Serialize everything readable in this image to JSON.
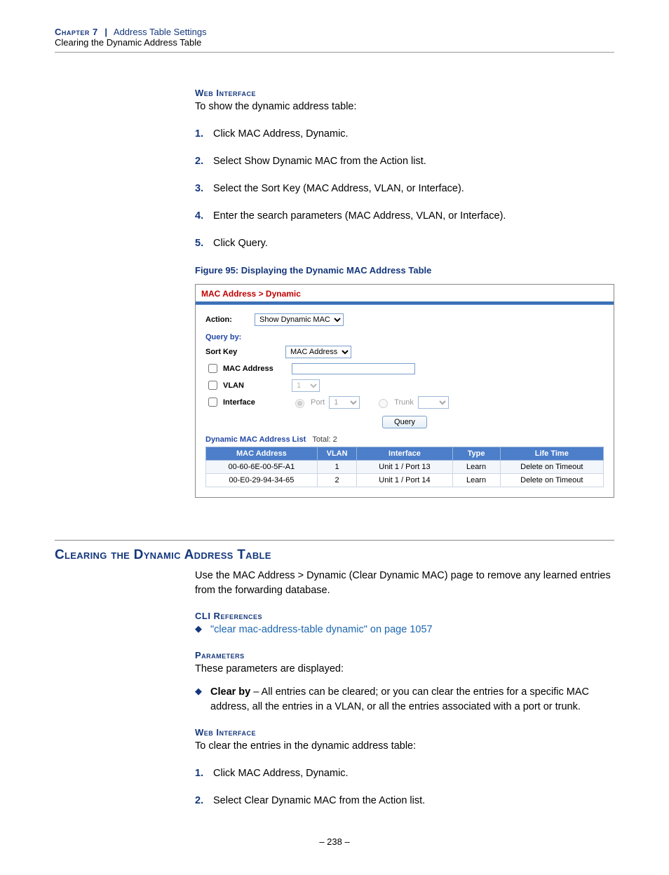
{
  "running_head": {
    "chapter": "Chapter 7",
    "sep": "|",
    "title": "Address Table Settings",
    "subtitle": "Clearing the Dynamic Address Table"
  },
  "sec_web_interface": "Web Interface",
  "intro_show": "To show the dynamic address table:",
  "steps_show": [
    "Click MAC Address, Dynamic.",
    "Select Show Dynamic MAC from the Action list.",
    "Select the Sort Key (MAC Address, VLAN, or Interface).",
    "Enter the search parameters (MAC Address, VLAN, or Interface).",
    "Click Query."
  ],
  "figure_caption": "Figure 95:  Displaying the Dynamic MAC Address Table",
  "panel": {
    "breadcrumb": "MAC Address > Dynamic",
    "action_label": "Action:",
    "action_value": "Show Dynamic MAC",
    "query_by": "Query by:",
    "sort_key_label": "Sort Key",
    "sort_key_value": "MAC Address",
    "opt_mac": "MAC Address",
    "opt_vlan": "VLAN",
    "vlan_value": "1",
    "opt_interface": "Interface",
    "radio_port_label": "Port",
    "port_value": "1",
    "radio_trunk_label": "Trunk",
    "query_btn": "Query",
    "list_title": "Dynamic MAC Address List",
    "list_total_label": "Total:",
    "list_total": "2",
    "columns": [
      "MAC Address",
      "VLAN",
      "Interface",
      "Type",
      "Life Time"
    ],
    "rows": [
      {
        "mac": "00-60-6E-00-5F-A1",
        "vlan": "1",
        "iface": "Unit 1 / Port 13",
        "type": "Learn",
        "life": "Delete on Timeout"
      },
      {
        "mac": "00-E0-29-94-34-65",
        "vlan": "2",
        "iface": "Unit 1 / Port 14",
        "type": "Learn",
        "life": "Delete on Timeout"
      }
    ]
  },
  "heading_clear": "Clearing the Dynamic Address Table",
  "clear_intro": "Use the MAC Address > Dynamic (Clear Dynamic MAC) page to remove any learned entries from the forwarding database.",
  "sec_cli": "CLI References",
  "cli_link": "\"clear mac-address-table dynamic\" on page 1057",
  "sec_params": "Parameters",
  "params_intro": "These parameters are displayed:",
  "param_clear_by_name": "Clear by",
  "param_clear_by_text": " – All entries can be cleared; or you can clear the entries for a specific MAC address, all the entries in a VLAN, or all the entries associated with a port or trunk.",
  "intro_clear": "To clear the entries in the dynamic address table:",
  "steps_clear": [
    "Click MAC Address, Dynamic.",
    "Select Clear Dynamic MAC from the Action list."
  ],
  "page_number": "–  238  –"
}
